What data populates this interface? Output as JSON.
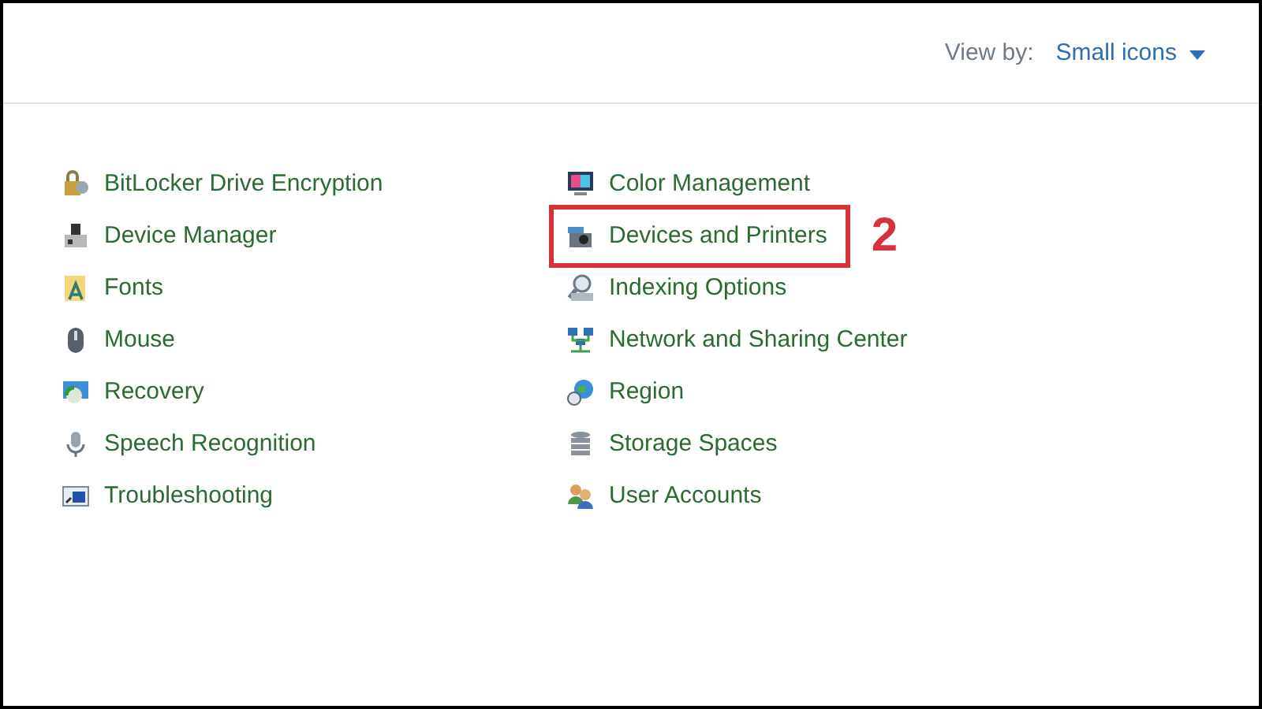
{
  "view_by": {
    "label": "View by:",
    "value": "Small icons"
  },
  "columns": [
    [
      {
        "label": "BitLocker Drive Encryption",
        "highlighted": false
      },
      {
        "label": "Device Manager",
        "highlighted": false
      },
      {
        "label": "Fonts",
        "highlighted": false
      },
      {
        "label": "Mouse",
        "highlighted": false
      },
      {
        "label": "Recovery",
        "highlighted": false
      },
      {
        "label": "Speech Recognition",
        "highlighted": false
      },
      {
        "label": "Troubleshooting",
        "highlighted": false
      }
    ],
    [
      {
        "label": "Color Management",
        "highlighted": false
      },
      {
        "label": "Devices and Printers",
        "highlighted": true,
        "annotation": "2"
      },
      {
        "label": "Indexing Options",
        "highlighted": false
      },
      {
        "label": "Network and Sharing Center",
        "highlighted": false
      },
      {
        "label": "Region",
        "highlighted": false
      },
      {
        "label": "Storage Spaces",
        "highlighted": false
      },
      {
        "label": "User Accounts",
        "highlighted": false
      }
    ]
  ]
}
